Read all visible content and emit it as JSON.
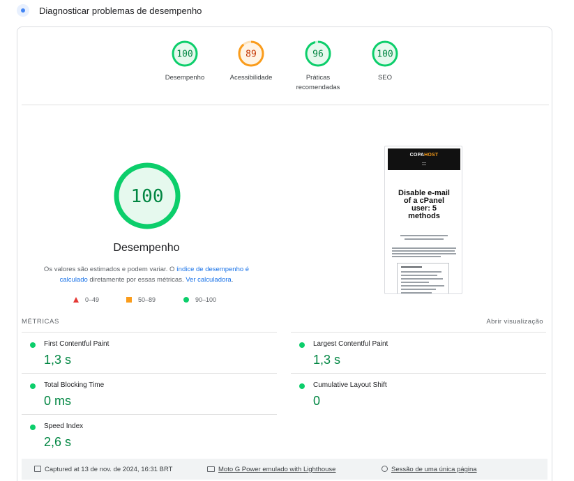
{
  "header": {
    "title": "Diagnosticar problemas de desempenho"
  },
  "colors": {
    "pass": "#0cce6b",
    "pass_text": "#018642",
    "average": "#fa9c1b",
    "average_text": "#c33300",
    "fail": "#e53935",
    "link": "#1a73e8"
  },
  "gauges": [
    {
      "score": "100",
      "label_1": "Desempenho",
      "label_2": "",
      "status": "pass"
    },
    {
      "score": "89",
      "label_1": "Acessibilidade",
      "label_2": "",
      "status": "average"
    },
    {
      "score": "96",
      "label_1": "Práticas",
      "label_2": "recomendadas",
      "status": "pass"
    },
    {
      "score": "100",
      "label_1": "SEO",
      "label_2": "",
      "status": "pass"
    }
  ],
  "main": {
    "score": "100",
    "title": "Desempenho",
    "desc_part1": "Os valores são estimados e podem variar. O ",
    "desc_link1": "índice de desempenho é calculado",
    "desc_part2": " diretamente por essas métricas. ",
    "desc_link2": "Ver calculadora",
    "desc_part3": "."
  },
  "legend": {
    "fail": "0–49",
    "average": "50–89",
    "pass": "90–100"
  },
  "screenshot": {
    "logo_a": "COPA",
    "logo_b": "HOST",
    "heading_1": "Disable e-mail",
    "heading_2": "of a cPanel",
    "heading_3": "user: 5",
    "heading_4": "methods"
  },
  "metrics": {
    "heading": "MÉTRICAS",
    "toggle": "Abrir visualização",
    "items": [
      {
        "name": "First Contentful Paint",
        "value": "1,3 s"
      },
      {
        "name": "Largest Contentful Paint",
        "value": "1,3 s"
      },
      {
        "name": "Total Blocking Time",
        "value": "0 ms"
      },
      {
        "name": "Cumulative Layout Shift",
        "value": "0"
      },
      {
        "name": "Speed Index",
        "value": "2,6 s"
      }
    ]
  },
  "footer": {
    "captured": "Captured at 13 de nov. de 2024, 16:31 BRT",
    "device": "Moto G Power emulado with Lighthouse",
    "session": "Sessão de uma única página"
  }
}
